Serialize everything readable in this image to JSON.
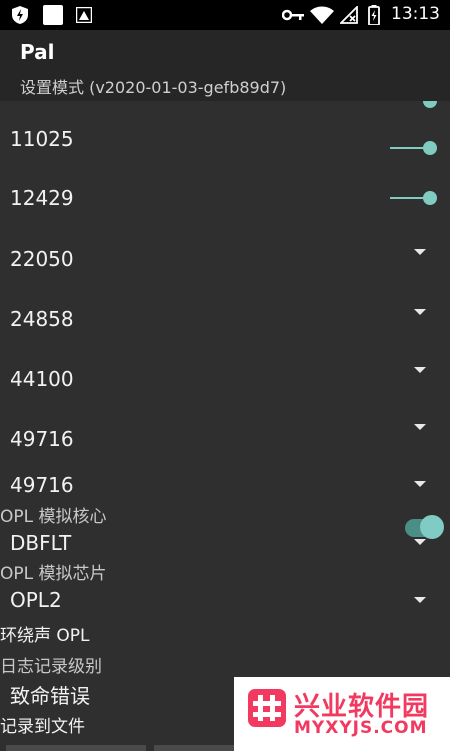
{
  "status_bar": {
    "time": "13:13",
    "icons": [
      "shield-icon",
      "notification-square-icon",
      "image-icon",
      "key-icon",
      "wifi-icon",
      "no-sim-icon",
      "battery-charging-icon"
    ]
  },
  "app_bar": {
    "title": "Pal",
    "subtitle": "设置模式 (v2020-01-03-gefb89d7)"
  },
  "sample_rates": [
    {
      "value": "11025",
      "control": "slider",
      "level": 1.0
    },
    {
      "value": "12429",
      "control": "slider",
      "level": 1.0
    },
    {
      "value": "22050",
      "control": "dropdown"
    },
    {
      "value": "24858",
      "control": "dropdown"
    },
    {
      "value": "44100",
      "control": "dropdown"
    },
    {
      "value": "49716",
      "control": "dropdown"
    },
    {
      "value": "49716",
      "control": "dropdown"
    }
  ],
  "opl_core": {
    "label": "OPL 模拟核心",
    "value": "DBFLT"
  },
  "opl_chip": {
    "label": "OPL 模拟芯片",
    "value": "OPL2"
  },
  "surround_opl": {
    "label": "环绕声 OPL",
    "enabled": true
  },
  "log_level": {
    "label": "日志记录级别",
    "value": "致命错误"
  },
  "log_to_file": {
    "label": "记录到文件"
  },
  "watermark": {
    "text_cn": "兴业软件园",
    "text_en": "MYXYJS.COM"
  },
  "colors": {
    "accent": "#80cbc4",
    "background": "#2f2f2f",
    "app_bar": "#262626",
    "watermark": "#f23a61"
  }
}
